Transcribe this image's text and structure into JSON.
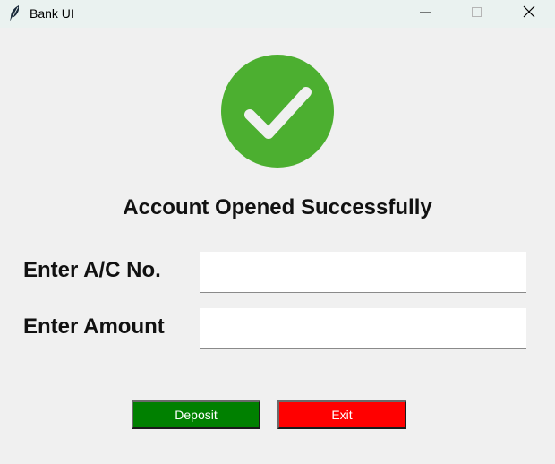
{
  "window": {
    "title": "Bank UI",
    "app_icon": "feather-icon",
    "controls": {
      "minimize": "minimize-icon",
      "maximize": "maximize-icon",
      "close": "close-icon"
    }
  },
  "status": {
    "icon": "check-circle-icon",
    "icon_color": "#4caf30",
    "message": "Account Opened Successfully"
  },
  "form": {
    "account_label": "Enter A/C No.",
    "account_value": "",
    "amount_label": "Enter Amount",
    "amount_value": ""
  },
  "actions": {
    "deposit_label": "Deposit",
    "deposit_color": "#008000",
    "exit_label": "Exit",
    "exit_color": "#ff0000"
  }
}
